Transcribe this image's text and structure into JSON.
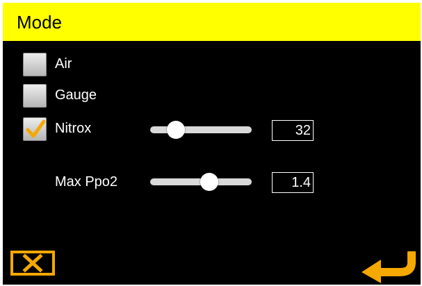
{
  "header": {
    "title": "Mode"
  },
  "options": [
    {
      "label": "Air",
      "checked": false
    },
    {
      "label": "Gauge",
      "checked": false
    },
    {
      "label": "Nitrox",
      "checked": true
    }
  ],
  "nitrox": {
    "value": "32",
    "level": 0.2
  },
  "max_ppo2": {
    "label": "Max Ppo2",
    "value": "1.4",
    "level": 0.6
  },
  "footer": {
    "cancel_icon": "close-icon",
    "confirm_icon": "return-arrow-icon"
  },
  "colors": {
    "header_bg": "#ffff00",
    "screen_bg": "#000000",
    "accent": "#f5a800",
    "text": "#ffffff"
  }
}
